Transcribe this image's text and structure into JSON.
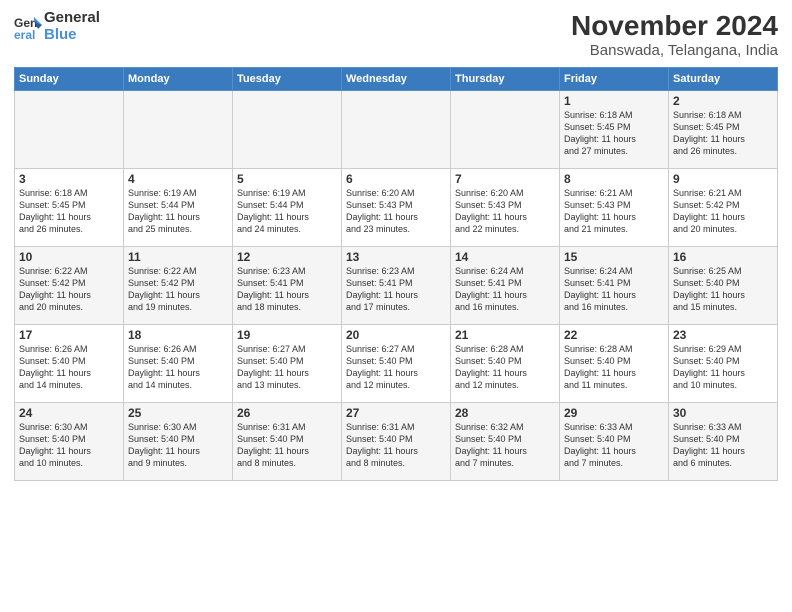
{
  "logo": {
    "line1": "General",
    "line2": "Blue"
  },
  "title": "November 2024",
  "subtitle": "Banswada, Telangana, India",
  "headers": [
    "Sunday",
    "Monday",
    "Tuesday",
    "Wednesday",
    "Thursday",
    "Friday",
    "Saturday"
  ],
  "weeks": [
    [
      {
        "day": "",
        "info": ""
      },
      {
        "day": "",
        "info": ""
      },
      {
        "day": "",
        "info": ""
      },
      {
        "day": "",
        "info": ""
      },
      {
        "day": "",
        "info": ""
      },
      {
        "day": "1",
        "info": "Sunrise: 6:18 AM\nSunset: 5:45 PM\nDaylight: 11 hours\nand 27 minutes."
      },
      {
        "day": "2",
        "info": "Sunrise: 6:18 AM\nSunset: 5:45 PM\nDaylight: 11 hours\nand 26 minutes."
      }
    ],
    [
      {
        "day": "3",
        "info": "Sunrise: 6:18 AM\nSunset: 5:45 PM\nDaylight: 11 hours\nand 26 minutes."
      },
      {
        "day": "4",
        "info": "Sunrise: 6:19 AM\nSunset: 5:44 PM\nDaylight: 11 hours\nand 25 minutes."
      },
      {
        "day": "5",
        "info": "Sunrise: 6:19 AM\nSunset: 5:44 PM\nDaylight: 11 hours\nand 24 minutes."
      },
      {
        "day": "6",
        "info": "Sunrise: 6:20 AM\nSunset: 5:43 PM\nDaylight: 11 hours\nand 23 minutes."
      },
      {
        "day": "7",
        "info": "Sunrise: 6:20 AM\nSunset: 5:43 PM\nDaylight: 11 hours\nand 22 minutes."
      },
      {
        "day": "8",
        "info": "Sunrise: 6:21 AM\nSunset: 5:43 PM\nDaylight: 11 hours\nand 21 minutes."
      },
      {
        "day": "9",
        "info": "Sunrise: 6:21 AM\nSunset: 5:42 PM\nDaylight: 11 hours\nand 20 minutes."
      }
    ],
    [
      {
        "day": "10",
        "info": "Sunrise: 6:22 AM\nSunset: 5:42 PM\nDaylight: 11 hours\nand 20 minutes."
      },
      {
        "day": "11",
        "info": "Sunrise: 6:22 AM\nSunset: 5:42 PM\nDaylight: 11 hours\nand 19 minutes."
      },
      {
        "day": "12",
        "info": "Sunrise: 6:23 AM\nSunset: 5:41 PM\nDaylight: 11 hours\nand 18 minutes."
      },
      {
        "day": "13",
        "info": "Sunrise: 6:23 AM\nSunset: 5:41 PM\nDaylight: 11 hours\nand 17 minutes."
      },
      {
        "day": "14",
        "info": "Sunrise: 6:24 AM\nSunset: 5:41 PM\nDaylight: 11 hours\nand 16 minutes."
      },
      {
        "day": "15",
        "info": "Sunrise: 6:24 AM\nSunset: 5:41 PM\nDaylight: 11 hours\nand 16 minutes."
      },
      {
        "day": "16",
        "info": "Sunrise: 6:25 AM\nSunset: 5:40 PM\nDaylight: 11 hours\nand 15 minutes."
      }
    ],
    [
      {
        "day": "17",
        "info": "Sunrise: 6:26 AM\nSunset: 5:40 PM\nDaylight: 11 hours\nand 14 minutes."
      },
      {
        "day": "18",
        "info": "Sunrise: 6:26 AM\nSunset: 5:40 PM\nDaylight: 11 hours\nand 14 minutes."
      },
      {
        "day": "19",
        "info": "Sunrise: 6:27 AM\nSunset: 5:40 PM\nDaylight: 11 hours\nand 13 minutes."
      },
      {
        "day": "20",
        "info": "Sunrise: 6:27 AM\nSunset: 5:40 PM\nDaylight: 11 hours\nand 12 minutes."
      },
      {
        "day": "21",
        "info": "Sunrise: 6:28 AM\nSunset: 5:40 PM\nDaylight: 11 hours\nand 12 minutes."
      },
      {
        "day": "22",
        "info": "Sunrise: 6:28 AM\nSunset: 5:40 PM\nDaylight: 11 hours\nand 11 minutes."
      },
      {
        "day": "23",
        "info": "Sunrise: 6:29 AM\nSunset: 5:40 PM\nDaylight: 11 hours\nand 10 minutes."
      }
    ],
    [
      {
        "day": "24",
        "info": "Sunrise: 6:30 AM\nSunset: 5:40 PM\nDaylight: 11 hours\nand 10 minutes."
      },
      {
        "day": "25",
        "info": "Sunrise: 6:30 AM\nSunset: 5:40 PM\nDaylight: 11 hours\nand 9 minutes."
      },
      {
        "day": "26",
        "info": "Sunrise: 6:31 AM\nSunset: 5:40 PM\nDaylight: 11 hours\nand 8 minutes."
      },
      {
        "day": "27",
        "info": "Sunrise: 6:31 AM\nSunset: 5:40 PM\nDaylight: 11 hours\nand 8 minutes."
      },
      {
        "day": "28",
        "info": "Sunrise: 6:32 AM\nSunset: 5:40 PM\nDaylight: 11 hours\nand 7 minutes."
      },
      {
        "day": "29",
        "info": "Sunrise: 6:33 AM\nSunset: 5:40 PM\nDaylight: 11 hours\nand 7 minutes."
      },
      {
        "day": "30",
        "info": "Sunrise: 6:33 AM\nSunset: 5:40 PM\nDaylight: 11 hours\nand 6 minutes."
      }
    ]
  ]
}
